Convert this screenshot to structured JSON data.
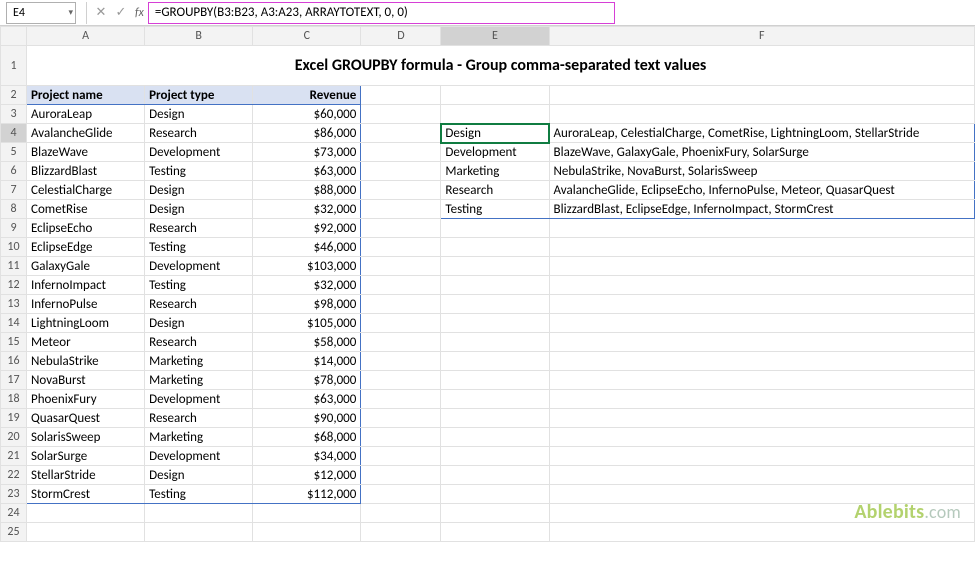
{
  "nameBox": "E4",
  "formulaBar": "=GROUPBY(B3:B23, A3:A23, ARRAYTOTEXT, 0, 0)",
  "title": "Excel GROUPBY formula - Group comma-separated text values",
  "columns": [
    "A",
    "B",
    "C",
    "D",
    "E",
    "F"
  ],
  "headers": {
    "A": "Project name",
    "B": "Project type",
    "C": "Revenue"
  },
  "sourceData": [
    {
      "name": "AuroraLeap",
      "type": "Design",
      "revenue": "$60,000"
    },
    {
      "name": "AvalancheGlide",
      "type": "Research",
      "revenue": "$86,000"
    },
    {
      "name": "BlazeWave",
      "type": "Development",
      "revenue": "$73,000"
    },
    {
      "name": "BlizzardBlast",
      "type": "Testing",
      "revenue": "$63,000"
    },
    {
      "name": "CelestialCharge",
      "type": "Design",
      "revenue": "$88,000"
    },
    {
      "name": "CometRise",
      "type": "Design",
      "revenue": "$32,000"
    },
    {
      "name": "EclipseEcho",
      "type": "Research",
      "revenue": "$92,000"
    },
    {
      "name": "EclipseEdge",
      "type": "Testing",
      "revenue": "$46,000"
    },
    {
      "name": "GalaxyGale",
      "type": "Development",
      "revenue": "$103,000"
    },
    {
      "name": "InfernoImpact",
      "type": "Testing",
      "revenue": "$32,000"
    },
    {
      "name": "InfernoPulse",
      "type": "Research",
      "revenue": "$98,000"
    },
    {
      "name": "LightningLoom",
      "type": "Design",
      "revenue": "$105,000"
    },
    {
      "name": "Meteor",
      "type": "Research",
      "revenue": "$58,000"
    },
    {
      "name": "NebulaStrike",
      "type": "Marketing",
      "revenue": "$14,000"
    },
    {
      "name": "NovaBurst",
      "type": "Marketing",
      "revenue": "$78,000"
    },
    {
      "name": "PhoenixFury",
      "type": "Development",
      "revenue": "$63,000"
    },
    {
      "name": "QuasarQuest",
      "type": "Research",
      "revenue": "$90,000"
    },
    {
      "name": "SolarisSweep",
      "type": "Marketing",
      "revenue": "$68,000"
    },
    {
      "name": "SolarSurge",
      "type": "Development",
      "revenue": "$34,000"
    },
    {
      "name": "StellarStride",
      "type": "Design",
      "revenue": "$12,000"
    },
    {
      "name": "StormCrest",
      "type": "Testing",
      "revenue": "$112,000"
    }
  ],
  "groupbyResult": [
    {
      "group": "Design",
      "items": "AuroraLeap, CelestialCharge, CometRise, LightningLoom, StellarStride"
    },
    {
      "group": "Development",
      "items": "BlazeWave, GalaxyGale, PhoenixFury, SolarSurge"
    },
    {
      "group": "Marketing",
      "items": "NebulaStrike, NovaBurst, SolarisSweep"
    },
    {
      "group": "Research",
      "items": "AvalancheGlide, EclipseEcho, InfernoPulse, Meteor, QuasarQuest"
    },
    {
      "group": "Testing",
      "items": "BlizzardBlast, EclipseEdge, InfernoImpact, StormCrest"
    }
  ],
  "watermark": {
    "brand": "Ablebits",
    "suffix": ".com"
  },
  "visibleRowCount": 25
}
